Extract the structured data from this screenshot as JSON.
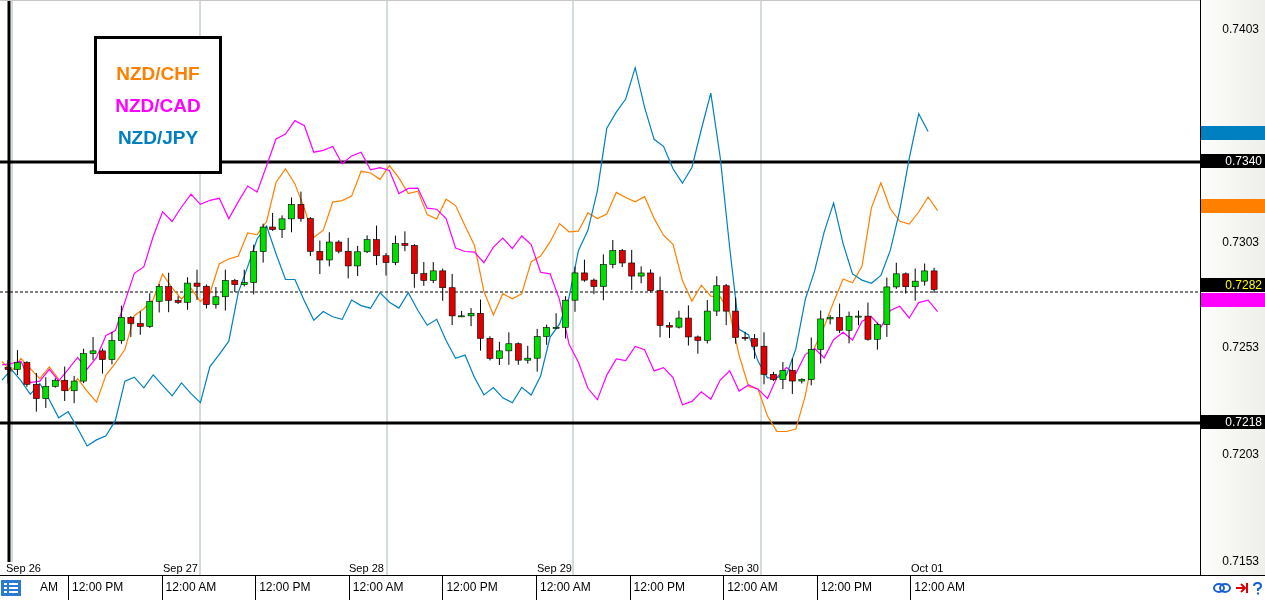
{
  "legend": [
    {
      "label": "NZD/CHF",
      "color": "#ff8000"
    },
    {
      "label": "NZD/CAD",
      "color": "#ff00ff"
    },
    {
      "label": "NZD/JPY",
      "color": "#0080c0"
    }
  ],
  "price_axis": {
    "ticks": [
      "0.7403",
      "0.7303",
      "0.7253",
      "0.7203",
      "0.7153"
    ]
  },
  "price_tags": [
    {
      "kind": "series",
      "color": "#0080c0"
    },
    {
      "kind": "level",
      "label": "0.7340"
    },
    {
      "kind": "series",
      "color": "#ff8000"
    },
    {
      "kind": "bid",
      "label": "0.7282"
    },
    {
      "kind": "series",
      "color": "#ff00ff"
    },
    {
      "kind": "level",
      "label": "0.7218"
    }
  ],
  "date_labels": [
    "Sep 26",
    "Sep 27",
    "Sep 28",
    "Sep 29",
    "Sep 30",
    "Oct 01"
  ],
  "time_axis": [
    "AM",
    "12:00 PM",
    "12:00 AM",
    "12:00 PM",
    "12:00 AM",
    "12:00 PM",
    "12:00 AM",
    "12:00 PM",
    "12:00 AM",
    "12:00 PM",
    "12:00 AM"
  ]
}
